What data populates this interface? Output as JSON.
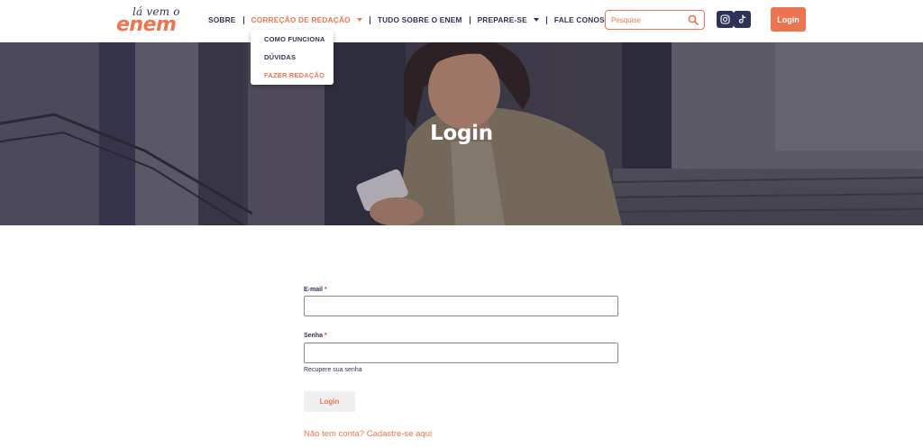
{
  "logo": {
    "line1": "lá vem o",
    "line2": "enem"
  },
  "nav": {
    "items": [
      {
        "label": "SOBRE"
      },
      {
        "label": "CORREÇÃO DE REDAÇÃO"
      },
      {
        "label": "TUDO SOBRE O ENEM"
      },
      {
        "label": "PREPARE-SE"
      },
      {
        "label": "FALE CONOSCO"
      }
    ]
  },
  "dropdown": {
    "items": [
      {
        "label": "COMO FUNCIONA"
      },
      {
        "label": "DÚVIDAS"
      },
      {
        "label": "FAZER REDAÇÃO"
      }
    ]
  },
  "search": {
    "placeholder": "Pesquise",
    "icon": "search-icon"
  },
  "social": {
    "instagram_icon": "instagram-icon",
    "tiktok_icon": "tiktok-icon"
  },
  "header_login": "Login",
  "hero": {
    "title": "Login"
  },
  "form": {
    "email_label": "E-mail",
    "password_label": "Senha",
    "required_mark": "*",
    "email_value": "",
    "password_value": "",
    "recover": "Recupere sua senha",
    "submit": "Login",
    "signup": "Não tem conta? Cadastre-se aqui"
  },
  "colors": {
    "accent": "#ec7551",
    "navy": "#2f3158"
  }
}
